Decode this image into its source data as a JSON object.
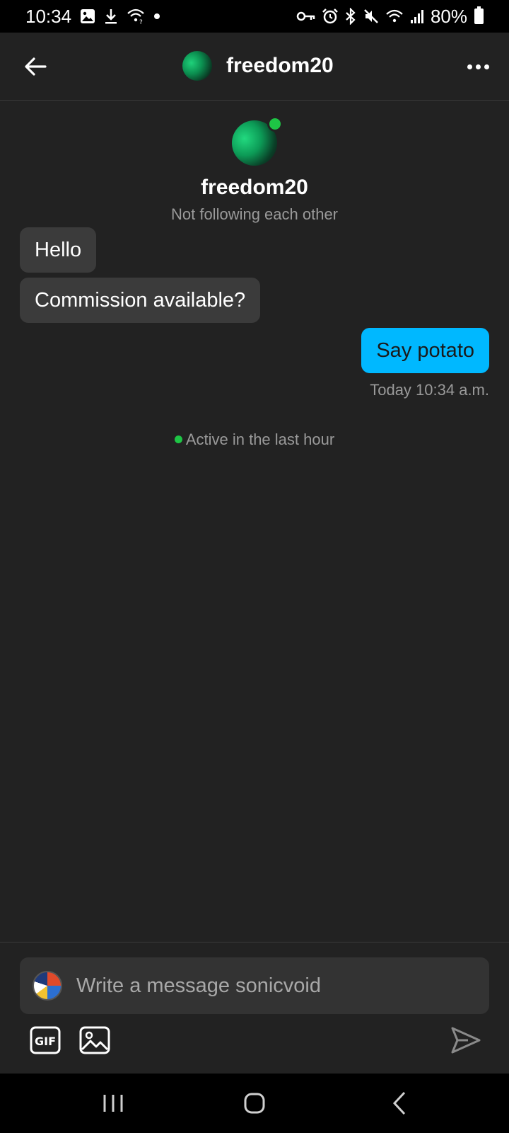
{
  "status_bar": {
    "time": "10:34",
    "battery": "80%",
    "icons_left": [
      "image-icon",
      "download-icon",
      "wifi-calling-icon",
      "dot-icon"
    ],
    "icons_right": [
      "vpn-key-icon",
      "alarm-icon",
      "bluetooth-icon",
      "mute-icon",
      "wifi-icon",
      "signal-icon",
      "battery-icon"
    ]
  },
  "header": {
    "title": "freedom20"
  },
  "profile": {
    "name": "freedom20",
    "relationship": "Not following each other"
  },
  "messages": [
    {
      "direction": "incoming",
      "text": "Hello"
    },
    {
      "direction": "incoming",
      "text": "Commission available?"
    },
    {
      "direction": "outgoing",
      "text": "Say potato"
    }
  ],
  "timestamp": "Today 10:34 a.m.",
  "activity": "Active in the last hour",
  "composer": {
    "placeholder": "Write a message sonicvoid",
    "value": ""
  },
  "colors": {
    "background": "#222222",
    "incoming_bubble": "#3b3b3b",
    "outgoing_bubble": "#00b8ff",
    "online": "#1ec545"
  }
}
